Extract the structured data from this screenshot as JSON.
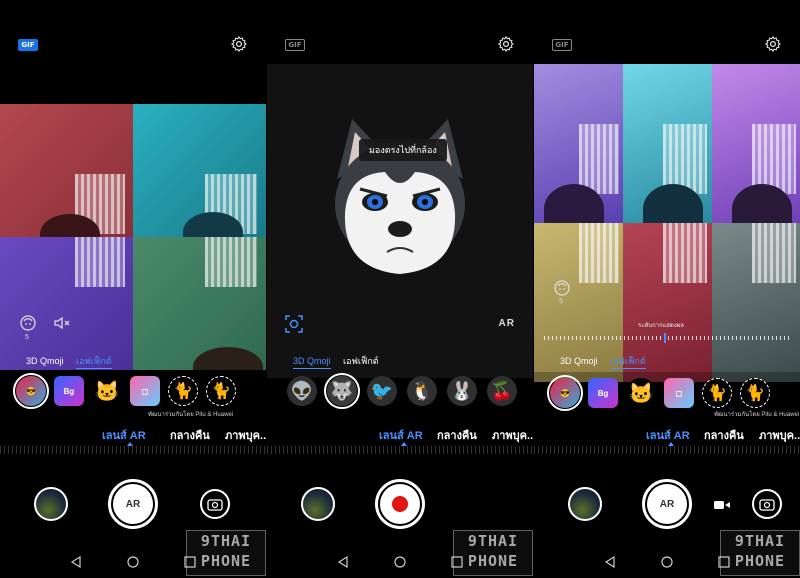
{
  "panels": [
    {
      "id": "qmoji-effects",
      "gif_active": true,
      "tabs": [
        "3D Qmoji",
        "เอฟเฟ็กต์"
      ],
      "active_tab": 1,
      "credit": "พัฒนาร่วมกันโดย Pitu & Huawei",
      "modes": [
        "เลนส์ AR",
        "กลางคืน",
        "ภาพบุค..."
      ],
      "active_mode": 0,
      "shutter": "AR",
      "counter": "5"
    },
    {
      "id": "qmoji-3d",
      "gif_active": false,
      "tip": "มองตรงไปที่กล้อง",
      "ar_label": "AR",
      "tabs": [
        "3D Qmoji",
        "เอฟเฟ็กต์"
      ],
      "active_tab": 0,
      "modes": [
        "เลนส์ AR",
        "กลางคืน",
        "ภาพบุค..."
      ],
      "active_mode": 0,
      "shutter": "record"
    },
    {
      "id": "qmoji-effects-level",
      "gif_active": false,
      "gif_label": "GIF",
      "slider_label": "ระดับการแสดงผล",
      "tabs": [
        "3D Qmoji",
        "เอฟเฟ็กต์"
      ],
      "active_tab": 1,
      "credit": "พัฒนาร่วมกันโดย Pitu & Huawei",
      "modes": [
        "เลนส์ AR",
        "กลางคืน",
        "ภาพบุค..."
      ],
      "active_mode": 0,
      "shutter": "AR",
      "counter": "5"
    }
  ],
  "gif_label": "GIF",
  "watermark": {
    "line1": "9THAI",
    "line2": "PHONE"
  },
  "colors": {
    "accent": "#4a90ff",
    "record": "#e01515"
  },
  "icons": [
    "gear-icon",
    "face-scan-icon",
    "mute-icon",
    "switch-camera-icon",
    "video-icon",
    "nav-back-icon",
    "nav-home-icon",
    "nav-recent-icon"
  ]
}
